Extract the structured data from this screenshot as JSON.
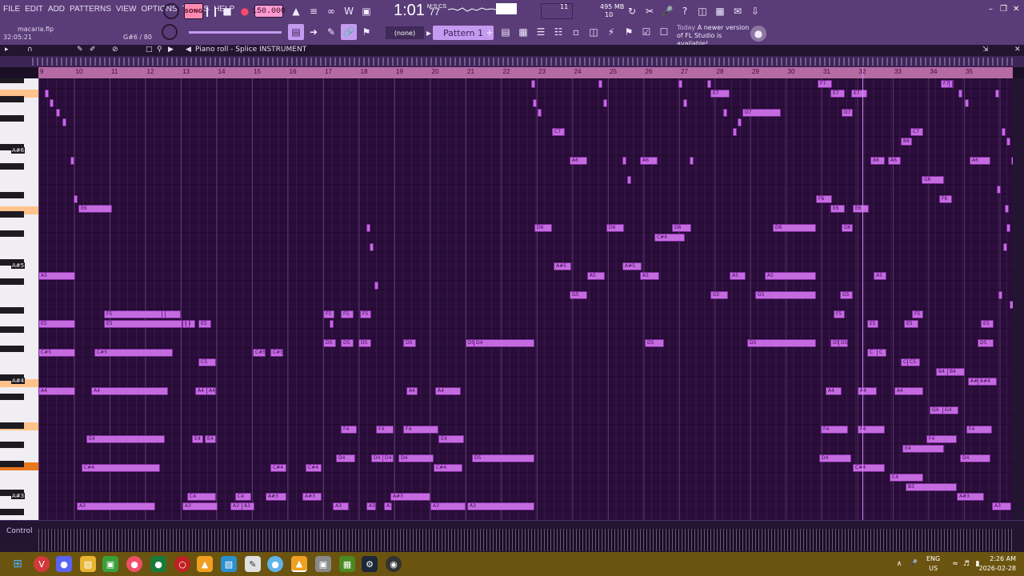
{
  "menu": [
    "FILE",
    "EDIT",
    "ADD",
    "PATTERNS",
    "VIEW",
    "OPTIONS",
    "TOOLS",
    "HELP"
  ],
  "transport": {
    "song_label": "SONG",
    "bpm": "150.000",
    "time": "1:01",
    "time_small": "77",
    "time_unit": "M:S:CS"
  },
  "status": {
    "memory": "495 MB",
    "cpu_num": "11",
    "voices": "10"
  },
  "project": {
    "file": "macaria.flp",
    "position": "32:05:21",
    "note_info": "G#6 / 80"
  },
  "pattern": {
    "name": "Pattern 1",
    "none": "(none)"
  },
  "news": {
    "day": "Today",
    "message": "A newer version of FL Studio is available!"
  },
  "piano_roll": {
    "title": "Piano roll - Splice INSTRUMENT"
  },
  "ruler": {
    "bars": [
      "9",
      "10",
      "11",
      "12",
      "13",
      "14",
      "15",
      "16",
      "17",
      "18",
      "19",
      "20",
      "21",
      "22",
      "23",
      "24",
      "25",
      "26",
      "27",
      "28",
      "29",
      "30",
      "31",
      "32",
      "33",
      "34",
      "35"
    ]
  },
  "keyboard": {
    "labels": [
      "A#6",
      "A#5",
      "A#4",
      "A#3"
    ]
  },
  "notes": [
    {
      "label": "E6"
    },
    {
      "label": "A5"
    },
    {
      "label": "E5"
    },
    {
      "label": "E5"
    },
    {
      "label": "F5"
    },
    {
      "label": "C#5"
    },
    {
      "label": "C#5"
    },
    {
      "label": "C5"
    },
    {
      "label": "A4"
    },
    {
      "label": "A4"
    },
    {
      "label": "A4"
    },
    {
      "label": "A4"
    },
    {
      "label": "E4"
    },
    {
      "label": "E4"
    },
    {
      "label": "E4"
    },
    {
      "label": "C#4"
    },
    {
      "label": "C4"
    },
    {
      "label": "C4"
    },
    {
      "label": "A#3"
    },
    {
      "label": "A#3"
    },
    {
      "label": "A3"
    },
    {
      "label": "A3"
    },
    {
      "label": "A3"
    },
    {
      "label": "A3"
    },
    {
      "label": "F5"
    },
    {
      "label": "F5"
    },
    {
      "label": "F5"
    },
    {
      "label": "D5"
    },
    {
      "label": "D5"
    },
    {
      "label": "D5"
    },
    {
      "label": "D5"
    },
    {
      "label": "D5"
    },
    {
      "label": "E5"
    },
    {
      "label": "E5"
    },
    {
      "label": "C#5"
    },
    {
      "label": "C#5"
    },
    {
      "label": "F4"
    },
    {
      "label": "F4"
    },
    {
      "label": "F4"
    },
    {
      "label": "D4"
    },
    {
      "label": "D4"
    },
    {
      "label": "D4"
    },
    {
      "label": "D4"
    },
    {
      "label": "C#4"
    },
    {
      "label": "C#4"
    },
    {
      "label": "A#3"
    },
    {
      "label": "A3"
    },
    {
      "label": "A3"
    },
    {
      "label": "A4"
    },
    {
      "label": "A4"
    },
    {
      "label": "E4"
    },
    {
      "label": "C#4"
    },
    {
      "label": "A3"
    },
    {
      "label": "A3"
    },
    {
      "label": "D5"
    },
    {
      "label": "D4"
    },
    {
      "label": "A3"
    },
    {
      "label": "C7"
    },
    {
      "label": "A6"
    },
    {
      "label": "D6"
    },
    {
      "label": "A#5"
    },
    {
      "label": "A5"
    },
    {
      "label": "G5"
    },
    {
      "label": "A6"
    },
    {
      "label": "D6"
    },
    {
      "label": "C#6"
    },
    {
      "label": "D6"
    },
    {
      "label": "A#5"
    },
    {
      "label": "A5"
    },
    {
      "label": "D5"
    },
    {
      "label": "E7"
    },
    {
      "label": "D7"
    },
    {
      "label": "G5"
    },
    {
      "label": "A5"
    },
    {
      "label": "D6"
    },
    {
      "label": "A5"
    },
    {
      "label": "G5"
    },
    {
      "label": "D5"
    },
    {
      "label": "F7"
    },
    {
      "label": "E7"
    },
    {
      "label": "E7"
    },
    {
      "label": "D7"
    },
    {
      "label": "F6"
    },
    {
      "label": "E6"
    },
    {
      "label": "E6"
    },
    {
      "label": "D6"
    },
    {
      "label": "G5"
    },
    {
      "label": "F5"
    },
    {
      "label": "D5"
    },
    {
      "label": "D5"
    },
    {
      "label": "A4"
    },
    {
      "label": "F4"
    },
    {
      "label": "D4"
    },
    {
      "label": "C#4"
    },
    {
      "label": "A6"
    },
    {
      "label": "A6"
    },
    {
      "label": "A5"
    },
    {
      "label": "E5"
    },
    {
      "label": "C"
    },
    {
      "label": "C"
    },
    {
      "label": "A4"
    },
    {
      "label": "F4"
    },
    {
      "label": "C4"
    },
    {
      "label": "B6"
    },
    {
      "label": "C7"
    },
    {
      "label": "G6"
    },
    {
      "label": "C5"
    },
    {
      "label": "C5"
    },
    {
      "label": "E5"
    },
    {
      "label": "F5"
    },
    {
      "label": "B4"
    },
    {
      "label": "B4"
    },
    {
      "label": "A4"
    },
    {
      "label": "G4"
    },
    {
      "label": "G4"
    },
    {
      "label": "F4"
    },
    {
      "label": "E4"
    },
    {
      "label": "B3"
    },
    {
      "label": "F7"
    },
    {
      "label": "F6"
    },
    {
      "label": "A6"
    },
    {
      "label": "E5"
    },
    {
      "label": "D5"
    },
    {
      "label": "A#4"
    },
    {
      "label": "A#4"
    },
    {
      "label": "F4"
    },
    {
      "label": "D4"
    },
    {
      "label": "A#3"
    },
    {
      "label": "A3"
    }
  ],
  "control": {
    "label": "Control"
  },
  "taskbar": {
    "lang1": "ENG",
    "lang2": "US",
    "time": "2:26 AM",
    "date": "2026-02-28"
  }
}
